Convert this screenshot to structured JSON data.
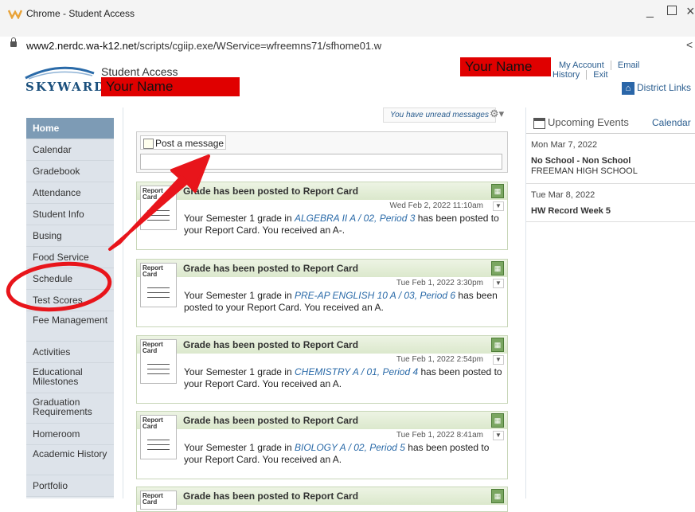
{
  "window": {
    "title": "Chrome - Student Access",
    "minimize": "_",
    "close": "×"
  },
  "address_bar": {
    "url_domain": "www2.nerdc.wa-k12.net",
    "url_path": "/scripts/cgiip.exe/WService=wfreemns71/sfhome01.w",
    "share": "<"
  },
  "header": {
    "logo_text": "SKYWARD",
    "app_title": "Student Access",
    "name_redacted_left": "Your Name",
    "name_redacted_right": "Your Name",
    "top_links": [
      "My Account",
      "Email History",
      "Exit"
    ],
    "district_links": "District Links"
  },
  "sidebar": {
    "items": [
      {
        "label": "Home",
        "active": true
      },
      {
        "label": "Calendar"
      },
      {
        "label": "Gradebook"
      },
      {
        "label": "Attendance"
      },
      {
        "label": "Student Info"
      },
      {
        "label": "Busing"
      },
      {
        "label": "Food Service"
      },
      {
        "label": "Schedule"
      },
      {
        "label": "Test Scores"
      },
      {
        "label": "Fee Management"
      },
      {
        "label": "Activities"
      },
      {
        "label": "Educational Milestones"
      },
      {
        "label": "Graduation Requirements"
      },
      {
        "label": "Homeroom"
      },
      {
        "label": "Academic History"
      },
      {
        "label": "Portfolio"
      }
    ]
  },
  "main": {
    "unread_messages": "You have unread messages",
    "post_message_label": "Post a message",
    "report_card_icon_text": "Report Card",
    "cards": [
      {
        "title": "Grade has been posted to Report Card",
        "date": "Wed Feb 2, 2022 11:10am",
        "pre": "Your Semester 1 grade in ",
        "course": "ALGEBRA II A / 02, Period 3",
        "post": " has been posted to your Report Card.  You received an A-."
      },
      {
        "title": "Grade has been posted to Report Card",
        "date": "Tue Feb 1, 2022 3:30pm",
        "pre": "Your Semester 1 grade in ",
        "course": "PRE-AP ENGLISH 10 A / 03, Period 6",
        "post": " has been posted to your Report Card.  You received an A."
      },
      {
        "title": "Grade has been posted to Report Card",
        "date": "Tue Feb 1, 2022 2:54pm",
        "pre": "Your Semester 1 grade in ",
        "course": "CHEMISTRY A / 01, Period 4",
        "post": " has been posted to your Report Card.  You received an A."
      },
      {
        "title": "Grade has been posted to Report Card",
        "date": "Tue Feb 1, 2022 8:41am",
        "pre": "Your Semester 1 grade in ",
        "course": "BIOLOGY A / 02, Period 5",
        "post": " has been posted to your Report Card.  You received an A."
      },
      {
        "title": "Grade has been posted to Report Card"
      }
    ]
  },
  "events": {
    "title": "Upcoming Events",
    "calendar_link": "Calendar",
    "items": [
      {
        "date": "Mon Mar 7, 2022",
        "title": "No School - Non School",
        "sub": "FREEMAN HIGH SCHOOL"
      },
      {
        "date": "Tue Mar 8, 2022",
        "title": "HW Record Week 5"
      }
    ]
  },
  "colors": {
    "annotation_red": "#e00000",
    "nav_active": "#7d9bb5",
    "link_blue": "#2a5d8f"
  }
}
